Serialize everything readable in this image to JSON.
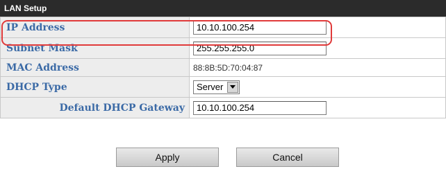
{
  "section": {
    "title": "LAN Setup"
  },
  "fields": {
    "ip_address": {
      "label": "IP Address",
      "value": "10.10.100.254"
    },
    "subnet_mask": {
      "label": "Subnet Mask",
      "value": "255.255.255.0"
    },
    "mac_address": {
      "label": "MAC Address",
      "value": "88:8B:5D:70:04:87"
    },
    "dhcp_type": {
      "label": "DHCP Type",
      "selected": "Server"
    },
    "default_gateway": {
      "label": "Default DHCP Gateway",
      "value": "10.10.100.254"
    }
  },
  "buttons": {
    "apply": "Apply",
    "cancel": "Cancel"
  },
  "colors": {
    "header_bg": "#2b2b2b",
    "label_text": "#3b6aa6",
    "highlight": "#e03a3a"
  }
}
